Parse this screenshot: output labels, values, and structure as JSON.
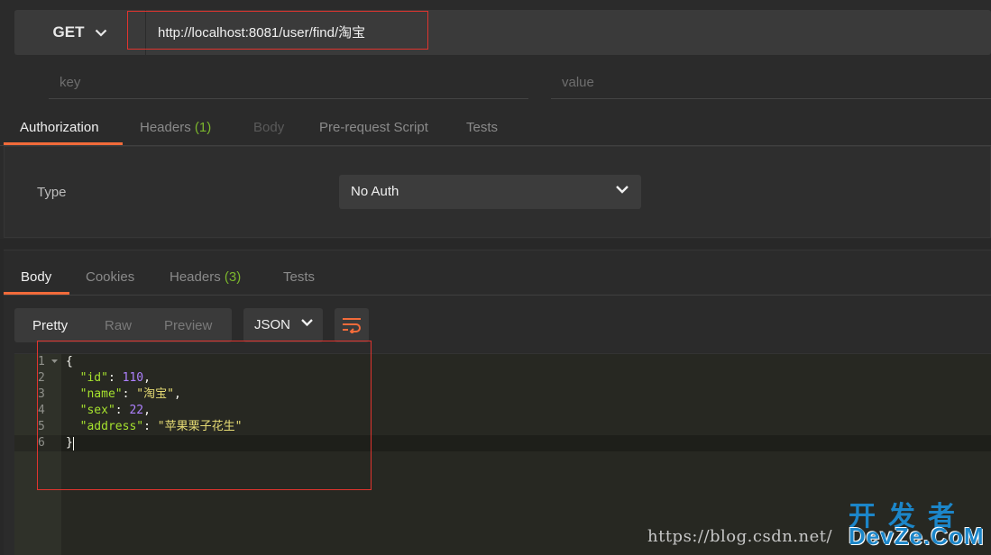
{
  "request": {
    "method": "GET",
    "url": "http://localhost:8081/user/find/淘宝",
    "params": {
      "key_placeholder": "key",
      "value_placeholder": "value"
    },
    "tabs": [
      {
        "label": "Authorization"
      },
      {
        "label": "Headers",
        "count": "(1)"
      },
      {
        "label": "Body"
      },
      {
        "label": "Pre-request Script"
      },
      {
        "label": "Tests"
      }
    ],
    "auth": {
      "type_label": "Type",
      "selected": "No Auth"
    }
  },
  "response": {
    "tabs": [
      {
        "label": "Body"
      },
      {
        "label": "Cookies"
      },
      {
        "label": "Headers",
        "count": "(3)"
      },
      {
        "label": "Tests"
      }
    ],
    "formats": [
      "Pretty",
      "Raw",
      "Preview"
    ],
    "language": "JSON",
    "line_numbers": [
      "1",
      "2",
      "3",
      "4",
      "5",
      "6"
    ],
    "body": {
      "open": "{",
      "close": "}",
      "fields": [
        {
          "key": "\"id\"",
          "value": "110",
          "type": "number",
          "comma": ","
        },
        {
          "key": "\"name\"",
          "value": "\"淘宝\"",
          "type": "string",
          "comma": ","
        },
        {
          "key": "\"sex\"",
          "value": "22",
          "type": "number",
          "comma": ","
        },
        {
          "key": "\"address\"",
          "value": "\"苹果栗子花生\"",
          "type": "string",
          "comma": ""
        }
      ]
    }
  },
  "watermark": {
    "url": "https://blog.csdn.net/",
    "brand_cn": "开发者",
    "brand_en": "DevZe.CoM"
  },
  "colors": {
    "accent": "#f26b3a",
    "count_green": "#7bb62c",
    "highlight_red": "#e0342e",
    "json_key": "#a6e22e",
    "json_number": "#ae81ff",
    "json_string": "#e6db74"
  }
}
